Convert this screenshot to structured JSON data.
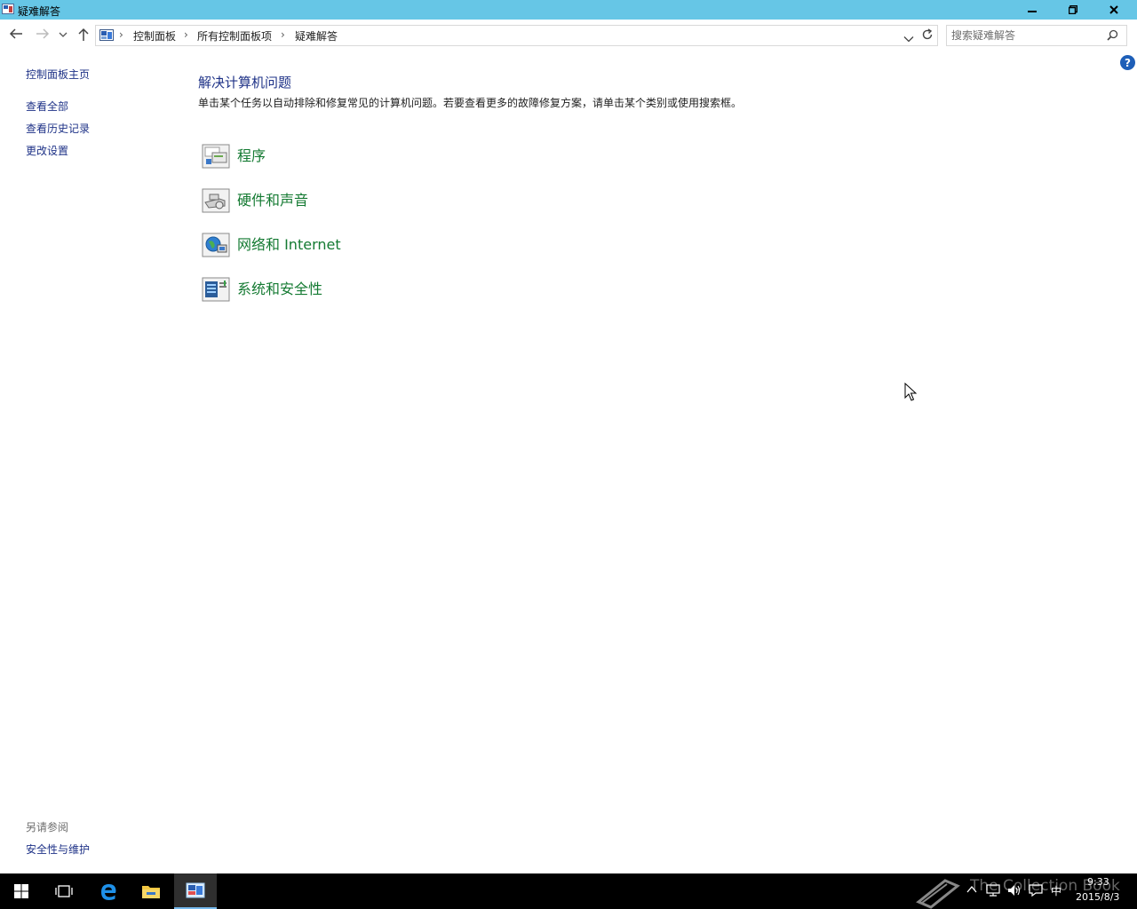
{
  "window": {
    "title": "疑难解答"
  },
  "breadcrumb": [
    "控制面板",
    "所有控制面板项",
    "疑难解答"
  ],
  "search": {
    "placeholder": "搜索疑难解答"
  },
  "sidebar": {
    "home": "控制面板主页",
    "links": [
      "查看全部",
      "查看历史记录",
      "更改设置"
    ],
    "see_also_title": "另请参阅",
    "see_also_links": [
      "安全性与维护"
    ]
  },
  "main": {
    "heading": "解决计算机问题",
    "description": "单击某个任务以自动排除和修复常见的计算机问题。若要查看更多的故障修复方案，请单击某个类别或使用搜索框。",
    "categories": [
      {
        "label": "程序",
        "icon": "programs-icon"
      },
      {
        "label": "硬件和声音",
        "icon": "hardware-sound-icon"
      },
      {
        "label": "网络和 Internet",
        "icon": "network-internet-icon"
      },
      {
        "label": "系统和安全性",
        "icon": "system-security-icon"
      }
    ]
  },
  "help": {
    "glyph": "?"
  },
  "taskbar": {
    "watermark": "The Collection Book",
    "time": "9:33",
    "date": "2015/8/3",
    "ime": "中"
  },
  "colors": {
    "titlebar": "#66c6e6",
    "link": "#1e3287",
    "category": "#147a32",
    "taskbar": "#000000"
  }
}
